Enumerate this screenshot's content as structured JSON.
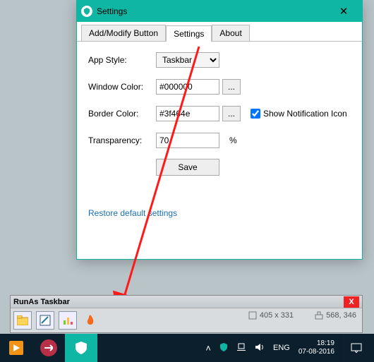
{
  "dialog": {
    "title": "Settings",
    "tabs": [
      "Add/Modify Button",
      "Settings",
      "About"
    ],
    "fields": {
      "app_style_label": "App Style:",
      "app_style_value": "Taskbar",
      "window_color_label": "Window Color:",
      "window_color_value": "#000000",
      "border_color_label": "Border Color:",
      "border_color_value": "#3f464e",
      "show_notif_label": "Show Notification Icon",
      "transparency_label": "Transparency:",
      "transparency_value": "70",
      "percent": "%",
      "save": "Save",
      "dots": "..."
    },
    "restore": "Restore default settings"
  },
  "runas": {
    "title": "RunAs Taskbar",
    "dims1": "405 x 331",
    "dims2": "568, 346"
  },
  "taskbar": {
    "lang": "ENG",
    "time": "18:19",
    "date": "07-08-2016"
  }
}
